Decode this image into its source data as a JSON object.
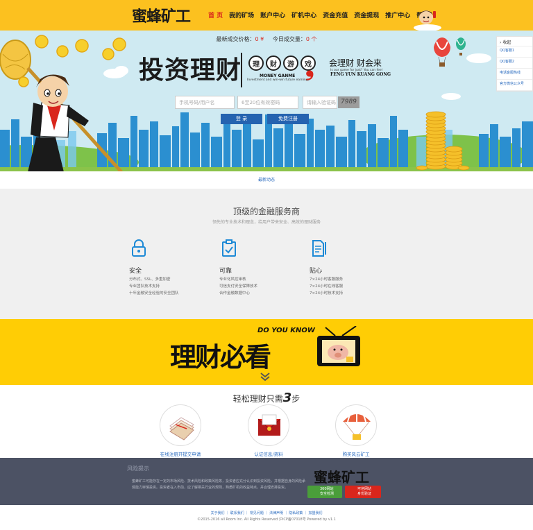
{
  "header": {
    "logo": "蜜蜂矿工",
    "nav": [
      "首 页",
      "我的矿场",
      "账户中心",
      "矿机中心",
      "资金充值",
      "资金提现",
      "推广中心",
      "帮助"
    ],
    "active_index": 0
  },
  "banner": {
    "stats": {
      "latest_price_label": "最新成交价格：",
      "latest_price_value": "0 ¥",
      "today_volume_label": "今日成交量：",
      "today_volume_value": "0 个"
    },
    "hero_title": "投资理财",
    "game_chars": [
      "理",
      "财",
      "游",
      "戏"
    ],
    "money_game": "MONEY GANME",
    "money_sub": "Investment and win-win future earnings",
    "slogan": "会理财 财会来",
    "slogan_sub": "Is our game for just? You can feel",
    "slogan_en": "FENG YUN KUANG GONG",
    "login": {
      "account_placeholder": "手机号码/用户名",
      "password_placeholder": "6至20位有效密码",
      "captcha_placeholder": "请输入验证码",
      "captcha_text": "7989",
      "login_button": "登 录",
      "register_button": "免费注册"
    }
  },
  "side_service": {
    "title": "收起",
    "items": [
      "QQ客服1",
      "QQ客服2",
      "电话客服热线",
      "官方微信公众号"
    ]
  },
  "recent_label": "最新动态",
  "services": {
    "title": "顶级的金融服务商",
    "subtitle": "领先的专业技术和理念，给用户带来安全、高效的理财服务",
    "features": [
      {
        "name": "安全",
        "icon": "lock-icon",
        "lines": [
          "分布式、SSL、多重加密",
          "专业团队技术支持",
          "十年金融安全经验的安全团队"
        ]
      },
      {
        "name": "可靠",
        "icon": "clipboard-check-icon",
        "lines": [
          "专业化风控审核",
          "可信支付安全保障技术",
          "合作金融数据中心"
        ]
      },
      {
        "name": "贴心",
        "icon": "document-icon",
        "lines": [
          "7×24小时客服服务",
          "7×24小时在线客服",
          "7×24小时技术支持"
        ]
      }
    ]
  },
  "must_read": {
    "title": "理财必看",
    "tag": "DO YOU KNOW"
  },
  "steps": {
    "title_prefix": "轻松理财只需",
    "title_num": "3",
    "title_suffix": "步",
    "items": [
      {
        "label": "在线注册开提交申请",
        "icon": "register-form-icon"
      },
      {
        "label": "认证信息/资料",
        "icon": "envelope-icon"
      },
      {
        "label": "购买风云矿工",
        "icon": "parachute-icon"
      }
    ]
  },
  "footer": {
    "risk_title": "风险提示",
    "risk_text": "蜜蜂矿工可能存在一定的市场风险、技术风险和政策风险等，投资者应充分认识到投资风险，并根据自身的风险承受能力审慎投资。投资者在入市前，应了解相关行业的规则，熟悉矿机的收益特点，并合理安排投资。",
    "logo": "蜜蜂矿工",
    "certs": [
      {
        "line1": "360网站",
        "line2": "安全检测",
        "color": "#4a9e3a"
      },
      {
        "line1": "可信网站",
        "line2": "身份验证",
        "color": "#d9261c"
      }
    ],
    "links": "关于我们 ｜ 联系我们 ｜ 常见问题 ｜ 法律声明 ｜ 隐私政策 ｜ 加盟我们",
    "copyright": "©2015-2016 all Room Inc. All Rights Reserved 沪ICP备07018号 Powered by v1.1"
  }
}
